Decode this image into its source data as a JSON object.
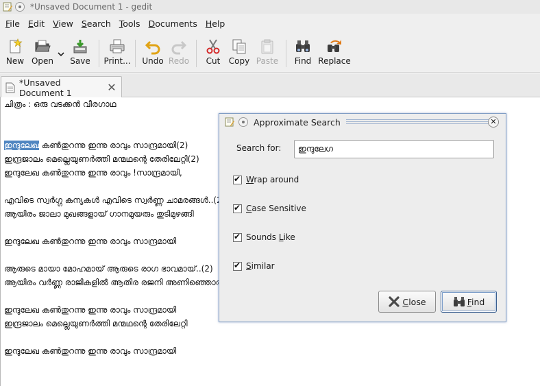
{
  "window": {
    "title": "*Unsaved Document 1 - gedit"
  },
  "menubar": {
    "items": [
      {
        "mnemonic": "F",
        "rest": "ile"
      },
      {
        "mnemonic": "E",
        "rest": "dit"
      },
      {
        "mnemonic": "V",
        "rest": "iew"
      },
      {
        "mnemonic": "S",
        "rest": "earch"
      },
      {
        "mnemonic": "T",
        "rest": "ools"
      },
      {
        "mnemonic": "D",
        "rest": "ocuments"
      },
      {
        "mnemonic": "H",
        "rest": "elp"
      }
    ]
  },
  "toolbar": {
    "new": "New",
    "open": "Open",
    "save": "Save",
    "print": "Print...",
    "undo": "Undo",
    "redo": "Redo",
    "cut": "Cut",
    "copy": "Copy",
    "paste": "Paste",
    "find": "Find",
    "replace": "Replace"
  },
  "tab": {
    "label": "*Unsaved Document 1"
  },
  "editor": {
    "selected_word": "ഇന്ദുലേഖ",
    "first_line_rest": " കണ്‍തുറന്നു ഇന്നു രാവും സാന്ദ്രമായി(2)",
    "lines": [
      "ചിത്രം : ഒരു വടക്കന്‍ വീരഗാഥ",
      "",
      "",
      "ഇന്ദ്രജാലം മെല്ലെയുണര്‍ത്തി മന്മഥന്റെ തേരിലേറ്റി(2)",
      "ഇന്ദുലേഖ കണ്‍തുറന്നു ഇന്നു രാവും !സാന്ദ്രമായി,",
      "",
      "എവിടെ സ്വര്‍ഗ്ഗ കന്യകള്‍ എവിടെ സ്വര്‍ണ്ണ ചാമരങ്ങള്‍..(2)",
      "ആയിരം ജാലാ മുഖങ്ങളായ് ഗാനമുയരും തുടിമുഴങ്ങി",
      "",
      "ഇന്ദുലേഖ കണ്‍തുറന്നു ഇന്നു രാവും സാന്ദ്രമായി",
      "",
      "ആരുടെ മായാ മോഹമായ് ആരുടെ രാഗ ഭാവമായ്..(2)",
      "ആയിരം വര്‍ണ്ണ രാജികളില്‍ ആതിര രജനി അണിഞ്ഞൊരു",
      "",
      "ഇന്ദുലേഖ കണ്‍തുറന്നു ഇന്നു രാവും സാന്ദ്രമായി",
      "ഇന്ദ്രജാലം മെല്ലെയുണര്‍ത്തി മന്മഥന്റെ തേരിലേറ്റി",
      "",
      "ഇന്ദുലേഖ കണ്‍തുറന്നു ഇന്നു രാവും സാന്ദ്രമായി"
    ]
  },
  "dialog": {
    "title": "Approximate Search",
    "search_label": "Search for:",
    "search_value": "ഇന്ദുലേഗ",
    "options": [
      {
        "mnemonic": "W",
        "rest": "rap around",
        "checked": true
      },
      {
        "mnemonic": "C",
        "rest": "ase Sensitive",
        "checked": true
      },
      {
        "pre": "Sounds ",
        "mnemonic": "L",
        "rest": "ike",
        "checked": true
      },
      {
        "mnemonic": "S",
        "rest": "imilar",
        "checked": true
      }
    ],
    "close_button": {
      "mnemonic": "C",
      "rest": "lose"
    },
    "find_button": {
      "mnemonic": "F",
      "rest": "ind"
    }
  }
}
